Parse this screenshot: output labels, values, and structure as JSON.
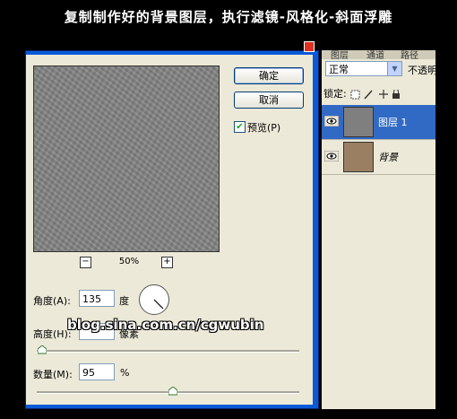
{
  "caption": "复制制作好的背景图层，执行滤镜-风格化-斜面浮雕",
  "dialog": {
    "ok_label": "确定",
    "cancel_label": "取消",
    "preview_label": "预览(P)",
    "preview_checked": true,
    "zoom_minus": "−",
    "zoom_plus": "+",
    "zoom_value": "50%",
    "angle_label": "角度(A):",
    "angle_value": "135",
    "angle_unit": "度",
    "height_label": "高度(H):",
    "height_unit": "像素",
    "amount_label": "数量(M):",
    "amount_value": "95",
    "amount_unit": "%"
  },
  "watermark": "blog.sina.com.cn/cgwubin",
  "layers_panel": {
    "tabs": [
      "图层",
      "通道",
      "路径"
    ],
    "blend_mode": "正常",
    "opacity_label": "不透明",
    "lock_label": "锁定:",
    "layers": [
      {
        "name": "图层 1",
        "selected": true,
        "thumb_color": "#7f7f7f"
      },
      {
        "name": "背景",
        "selected": false,
        "thumb_color": "#9b7f62"
      }
    ]
  }
}
